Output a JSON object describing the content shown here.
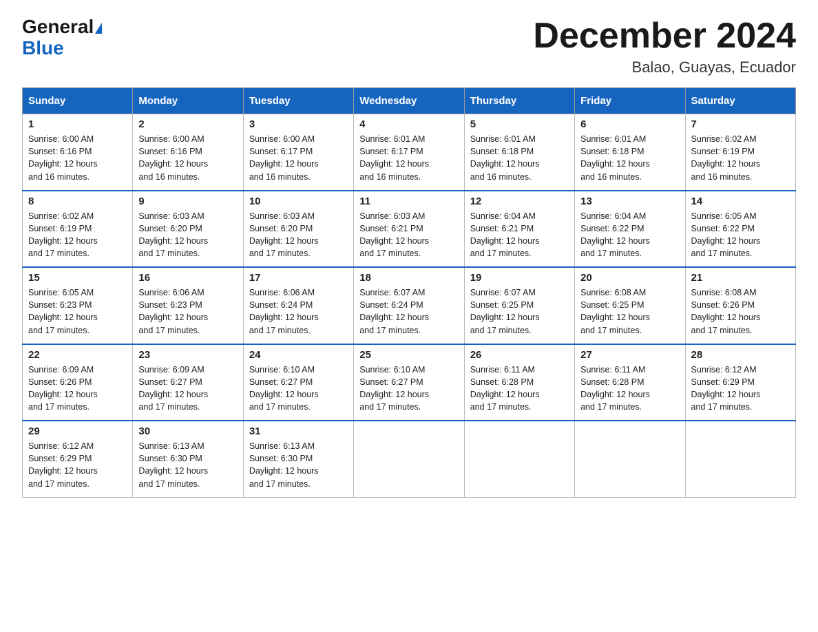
{
  "logo": {
    "general": "General",
    "blue": "Blue"
  },
  "header": {
    "month_title": "December 2024",
    "location": "Balao, Guayas, Ecuador"
  },
  "columns": [
    "Sunday",
    "Monday",
    "Tuesday",
    "Wednesday",
    "Thursday",
    "Friday",
    "Saturday"
  ],
  "weeks": [
    [
      {
        "day": "1",
        "sunrise": "6:00 AM",
        "sunset": "6:16 PM",
        "daylight": "12 hours and 16 minutes."
      },
      {
        "day": "2",
        "sunrise": "6:00 AM",
        "sunset": "6:16 PM",
        "daylight": "12 hours and 16 minutes."
      },
      {
        "day": "3",
        "sunrise": "6:00 AM",
        "sunset": "6:17 PM",
        "daylight": "12 hours and 16 minutes."
      },
      {
        "day": "4",
        "sunrise": "6:01 AM",
        "sunset": "6:17 PM",
        "daylight": "12 hours and 16 minutes."
      },
      {
        "day": "5",
        "sunrise": "6:01 AM",
        "sunset": "6:18 PM",
        "daylight": "12 hours and 16 minutes."
      },
      {
        "day": "6",
        "sunrise": "6:01 AM",
        "sunset": "6:18 PM",
        "daylight": "12 hours and 16 minutes."
      },
      {
        "day": "7",
        "sunrise": "6:02 AM",
        "sunset": "6:19 PM",
        "daylight": "12 hours and 16 minutes."
      }
    ],
    [
      {
        "day": "8",
        "sunrise": "6:02 AM",
        "sunset": "6:19 PM",
        "daylight": "12 hours and 17 minutes."
      },
      {
        "day": "9",
        "sunrise": "6:03 AM",
        "sunset": "6:20 PM",
        "daylight": "12 hours and 17 minutes."
      },
      {
        "day": "10",
        "sunrise": "6:03 AM",
        "sunset": "6:20 PM",
        "daylight": "12 hours and 17 minutes."
      },
      {
        "day": "11",
        "sunrise": "6:03 AM",
        "sunset": "6:21 PM",
        "daylight": "12 hours and 17 minutes."
      },
      {
        "day": "12",
        "sunrise": "6:04 AM",
        "sunset": "6:21 PM",
        "daylight": "12 hours and 17 minutes."
      },
      {
        "day": "13",
        "sunrise": "6:04 AM",
        "sunset": "6:22 PM",
        "daylight": "12 hours and 17 minutes."
      },
      {
        "day": "14",
        "sunrise": "6:05 AM",
        "sunset": "6:22 PM",
        "daylight": "12 hours and 17 minutes."
      }
    ],
    [
      {
        "day": "15",
        "sunrise": "6:05 AM",
        "sunset": "6:23 PM",
        "daylight": "12 hours and 17 minutes."
      },
      {
        "day": "16",
        "sunrise": "6:06 AM",
        "sunset": "6:23 PM",
        "daylight": "12 hours and 17 minutes."
      },
      {
        "day": "17",
        "sunrise": "6:06 AM",
        "sunset": "6:24 PM",
        "daylight": "12 hours and 17 minutes."
      },
      {
        "day": "18",
        "sunrise": "6:07 AM",
        "sunset": "6:24 PM",
        "daylight": "12 hours and 17 minutes."
      },
      {
        "day": "19",
        "sunrise": "6:07 AM",
        "sunset": "6:25 PM",
        "daylight": "12 hours and 17 minutes."
      },
      {
        "day": "20",
        "sunrise": "6:08 AM",
        "sunset": "6:25 PM",
        "daylight": "12 hours and 17 minutes."
      },
      {
        "day": "21",
        "sunrise": "6:08 AM",
        "sunset": "6:26 PM",
        "daylight": "12 hours and 17 minutes."
      }
    ],
    [
      {
        "day": "22",
        "sunrise": "6:09 AM",
        "sunset": "6:26 PM",
        "daylight": "12 hours and 17 minutes."
      },
      {
        "day": "23",
        "sunrise": "6:09 AM",
        "sunset": "6:27 PM",
        "daylight": "12 hours and 17 minutes."
      },
      {
        "day": "24",
        "sunrise": "6:10 AM",
        "sunset": "6:27 PM",
        "daylight": "12 hours and 17 minutes."
      },
      {
        "day": "25",
        "sunrise": "6:10 AM",
        "sunset": "6:27 PM",
        "daylight": "12 hours and 17 minutes."
      },
      {
        "day": "26",
        "sunrise": "6:11 AM",
        "sunset": "6:28 PM",
        "daylight": "12 hours and 17 minutes."
      },
      {
        "day": "27",
        "sunrise": "6:11 AM",
        "sunset": "6:28 PM",
        "daylight": "12 hours and 17 minutes."
      },
      {
        "day": "28",
        "sunrise": "6:12 AM",
        "sunset": "6:29 PM",
        "daylight": "12 hours and 17 minutes."
      }
    ],
    [
      {
        "day": "29",
        "sunrise": "6:12 AM",
        "sunset": "6:29 PM",
        "daylight": "12 hours and 17 minutes."
      },
      {
        "day": "30",
        "sunrise": "6:13 AM",
        "sunset": "6:30 PM",
        "daylight": "12 hours and 17 minutes."
      },
      {
        "day": "31",
        "sunrise": "6:13 AM",
        "sunset": "6:30 PM",
        "daylight": "12 hours and 17 minutes."
      },
      null,
      null,
      null,
      null
    ]
  ],
  "labels": {
    "sunrise": "Sunrise:",
    "sunset": "Sunset:",
    "daylight": "Daylight:"
  }
}
